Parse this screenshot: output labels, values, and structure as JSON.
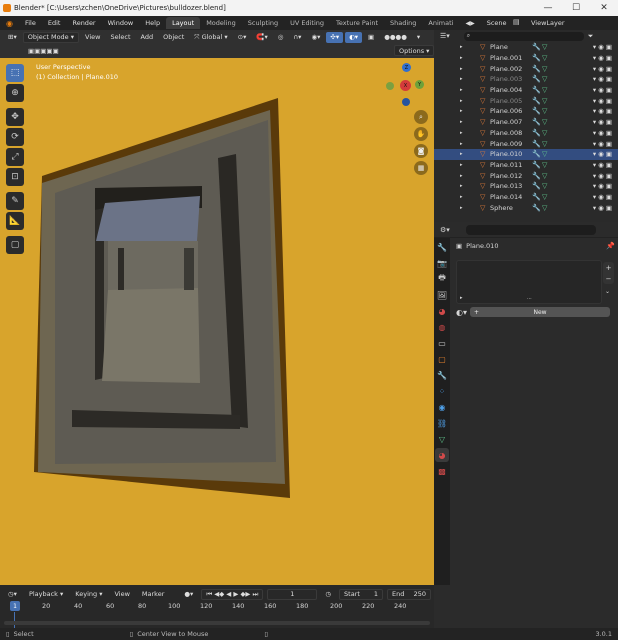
{
  "window": {
    "title": "Blender* [C:\\Users\\zchen\\OneDrive\\Pictures\\bulldozer.blend]",
    "min": "—",
    "max": "☐",
    "close": "✕"
  },
  "menu": {
    "file": "File",
    "edit": "Edit",
    "render": "Render",
    "window": "Window",
    "help": "Help"
  },
  "workspaces": [
    "Layout",
    "Modeling",
    "Sculpting",
    "UV Editing",
    "Texture Paint",
    "Shading",
    "Animati"
  ],
  "scene": {
    "scene_label": "Scene",
    "viewlayer_label": "ViewLayer"
  },
  "viewport_header": {
    "mode": "Object Mode",
    "view": "View",
    "select": "Select",
    "add": "Add",
    "object": "Object",
    "orientation": "Global",
    "options": "Options"
  },
  "viewport": {
    "perspective": "User Perspective",
    "collection": "(1) Collection | Plane.010",
    "gizmo_x": "X",
    "gizmo_y": "Y",
    "gizmo_z": "Z"
  },
  "outliner": {
    "search_placeholder": "",
    "items": [
      {
        "name": "Plane",
        "dim": false,
        "selected": false
      },
      {
        "name": "Plane.001",
        "dim": false,
        "selected": false
      },
      {
        "name": "Plane.002",
        "dim": false,
        "selected": false
      },
      {
        "name": "Plane.003",
        "dim": true,
        "selected": false
      },
      {
        "name": "Plane.004",
        "dim": false,
        "selected": false
      },
      {
        "name": "Plane.005",
        "dim": true,
        "selected": false
      },
      {
        "name": "Plane.006",
        "dim": false,
        "selected": false
      },
      {
        "name": "Plane.007",
        "dim": false,
        "selected": false
      },
      {
        "name": "Plane.008",
        "dim": false,
        "selected": false
      },
      {
        "name": "Plane.009",
        "dim": false,
        "selected": false
      },
      {
        "name": "Plane.010",
        "dim": false,
        "selected": true
      },
      {
        "name": "Plane.011",
        "dim": false,
        "selected": false
      },
      {
        "name": "Plane.012",
        "dim": false,
        "selected": false
      },
      {
        "name": "Plane.013",
        "dim": false,
        "selected": false
      },
      {
        "name": "Plane.014",
        "dim": false,
        "selected": false
      },
      {
        "name": "Sphere",
        "dim": false,
        "selected": false
      }
    ]
  },
  "properties": {
    "object_name": "Plane.010",
    "new_button": "New",
    "add": "+",
    "remove": "−"
  },
  "timeline": {
    "playback": "Playback",
    "keying": "Keying",
    "view": "View",
    "marker": "Marker",
    "current_frame": "1",
    "start_label": "Start",
    "start": "1",
    "end_label": "End",
    "end": "250",
    "ticks": [
      "1",
      "20",
      "40",
      "60",
      "80",
      "100",
      "120",
      "140",
      "160",
      "180",
      "200",
      "220",
      "240"
    ]
  },
  "status": {
    "select": "Select",
    "center": "Center View to Mouse",
    "version": "3.0.1"
  },
  "colors": {
    "viewport_bg": "#d8a42c",
    "selection": "#334d80",
    "accent": "#4772b3"
  }
}
